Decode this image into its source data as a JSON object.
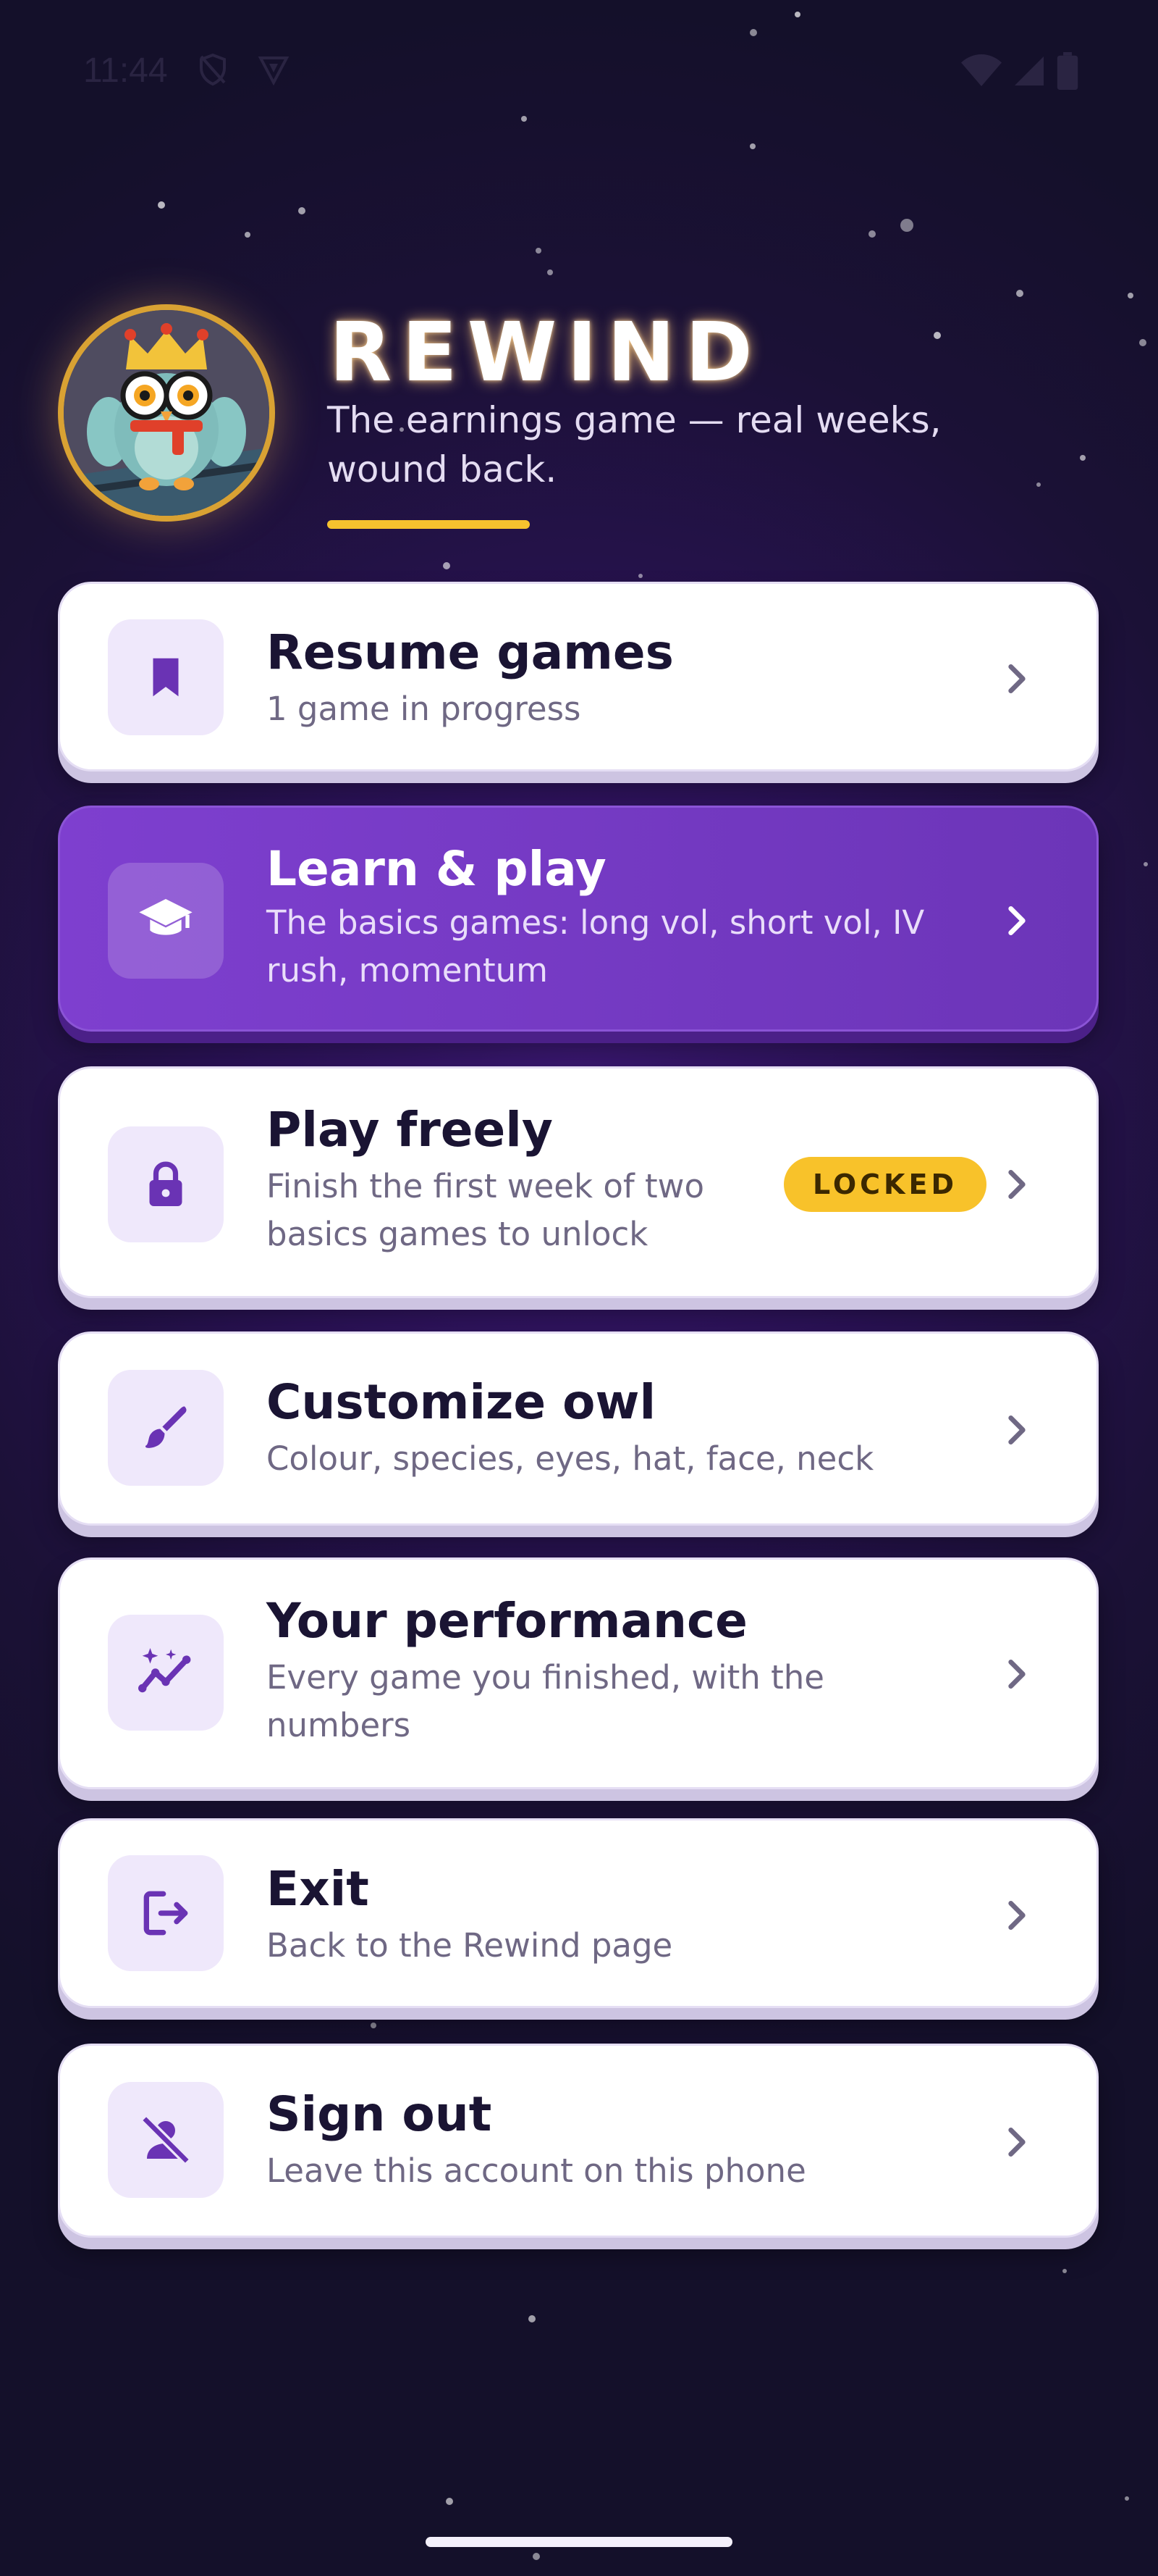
{
  "status_bar": {
    "time": "11:44",
    "icons_left": [
      "shield-off-icon",
      "vpn-badge-icon"
    ],
    "icons_right": [
      "wifi-icon",
      "cellular-signal-icon",
      "battery-icon"
    ]
  },
  "header": {
    "title": "REWIND",
    "tagline": "The earnings game — real weeks, wound back.",
    "avatar": "owl-avatar"
  },
  "menu": [
    {
      "id": "resume",
      "title": "Resume games",
      "subtitle": "1 game in progress",
      "icon": "bookmark-icon"
    },
    {
      "id": "learn",
      "title": "Learn & play",
      "subtitle": "The basics games: long vol, short vol, IV rush, momentum",
      "icon": "graduation-cap-icon",
      "featured": true
    },
    {
      "id": "play-freely",
      "title": "Play freely",
      "subtitle": "Finish the first week of two basics games to unlock",
      "icon": "lock-icon",
      "badge": "LOCKED"
    },
    {
      "id": "customize",
      "title": "Customize owl",
      "subtitle": "Colour, species, eyes, hat, face, neck",
      "icon": "paintbrush-icon"
    },
    {
      "id": "performance",
      "title": "Your performance",
      "subtitle": "Every game you finished, with the numbers",
      "icon": "sparkle-chart-icon"
    },
    {
      "id": "exit",
      "title": "Exit",
      "subtitle": "Back to the Rewind page",
      "icon": "exit-door-icon"
    },
    {
      "id": "sign-out",
      "title": "Sign out",
      "subtitle": "Leave this account on this phone",
      "icon": "person-off-icon"
    }
  ],
  "colors": {
    "background": "#1b1136",
    "accent_purple": "#7e3fcf",
    "icon_purple": "#6a33b4",
    "badge_yellow": "#f8c22a",
    "underline_yellow": "#f6c22e"
  }
}
